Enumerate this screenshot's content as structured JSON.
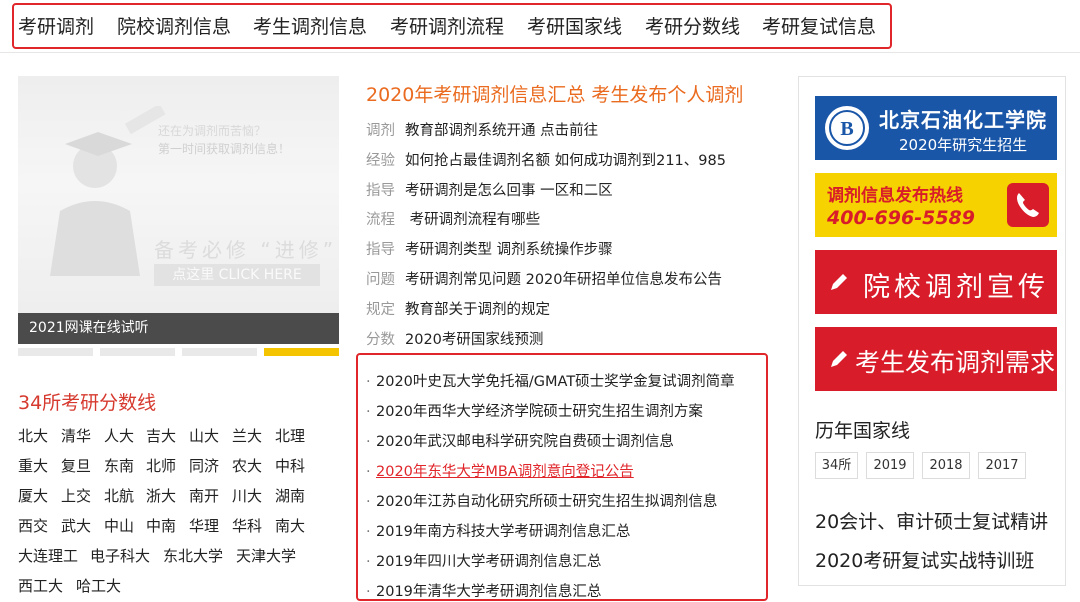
{
  "nav": {
    "items": [
      "考研调剂",
      "院校调剂信息",
      "考生调剂信息",
      "考研调剂流程",
      "考研国家线",
      "考研分数线",
      "考研复试信息"
    ]
  },
  "banner": {
    "line1": "还在为调剂而苦恼？",
    "line2": "第一时间获取调剂信息！",
    "big": "备考必修 “进修”",
    "click": "点这里 CLICK HERE",
    "caption": "2021网课在线试听"
  },
  "left": {
    "title": "34所考研分数线",
    "universities": [
      [
        "北大",
        "清华",
        "人大",
        "吉大",
        "山大",
        "兰大",
        "北理"
      ],
      [
        "重大",
        "复旦",
        "东南",
        "北师",
        "同济",
        "农大",
        "中科"
      ],
      [
        "厦大",
        "上交",
        "北航",
        "浙大",
        "南开",
        "川大",
        "湖南"
      ],
      [
        "西交",
        "武大",
        "中山",
        "中南",
        "华理",
        "华科",
        "南大"
      ],
      [
        "大连理工",
        "电子科大",
        "东北大学",
        "天津大学"
      ],
      [
        "西工大",
        "哈工大"
      ]
    ]
  },
  "middle": {
    "title": "2020年考研调剂信息汇总 考生发布个人调剂",
    "info_rows": [
      {
        "tag": "调剂",
        "text": "教育部调剂系统开通 点击前往"
      },
      {
        "tag": "经验",
        "text": "如何抢占最佳调剂名额 如何成功调剂到211、985"
      },
      {
        "tag": "指导",
        "text": "考研调剂是怎么回事 一区和二区"
      },
      {
        "tag": "流程",
        "text": " 考研调剂流程有哪些"
      },
      {
        "tag": "指导",
        "text": "考研调剂类型 调剂系统操作步骤"
      },
      {
        "tag": "问题",
        "text": "考研调剂常见问题 2020年研招单位信息发布公告"
      },
      {
        "tag": "规定",
        "text": "教育部关于调剂的规定"
      },
      {
        "tag": "分数",
        "text": "2020考研国家线预测"
      }
    ],
    "news": [
      "2020叶史瓦大学免托福/GMAT硕士奖学金复试调剂简章",
      "2020年西华大学经济学院硕士研究生招生调剂方案",
      "2020年武汉邮电科学研究院自费硕士调剂信息",
      "2020年东华大学MBA调剂意向登记公告",
      "2020年江苏自动化研究所硕士研究生招生拟调剂信息",
      "2019年南方科技大学考研调剂信息汇总",
      "2019年四川大学考研调剂信息汇总",
      "2019年清华大学考研调剂信息汇总"
    ]
  },
  "right": {
    "ad1_school": "北京石油化工学院",
    "ad1_sub": "2020年研究生招生",
    "ad2_title": "调剂信息发布热线",
    "ad2_phone": "400-696-5589",
    "ad3": "院校调剂宣传",
    "ad4": "考生发布调剂需求",
    "history_title": "历年国家线",
    "years": [
      "34所",
      "2019",
      "2018",
      "2017"
    ],
    "courses": [
      "20会计、审计硕士复试精讲",
      "2020考研复试实战特训班"
    ]
  },
  "colors": {
    "accent_red": "#e0262b",
    "title_orange": "#ea6b1f",
    "score_red": "#d63a2f",
    "slider_active": "#f4c400"
  }
}
